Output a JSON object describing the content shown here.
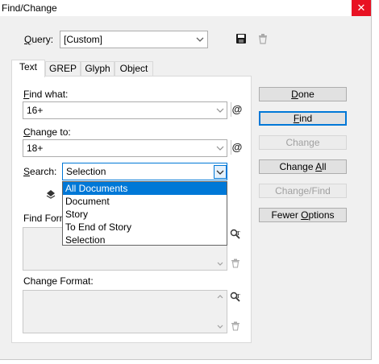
{
  "window": {
    "title": "Find/Change",
    "close_glyph": "✕"
  },
  "query": {
    "label_u": "Q",
    "label_rest": "uery:",
    "value": "[Custom]",
    "save_icon": "save-query-icon",
    "delete_icon": "delete-query-icon"
  },
  "tabs": [
    {
      "label": "Text"
    },
    {
      "label": "GREP"
    },
    {
      "label": "Glyph"
    },
    {
      "label": "Object"
    }
  ],
  "find_what": {
    "label_u": "F",
    "label_rest": "ind what:",
    "value": "16+",
    "special_char_glyph": "@"
  },
  "change_to": {
    "label_u": "C",
    "label_rest": "hange to:",
    "value": "18+",
    "special_char_glyph": "@"
  },
  "search": {
    "label_u": "S",
    "label_rest": "earch:",
    "value": "Selection",
    "options": [
      {
        "label": "All Documents",
        "selected": true
      },
      {
        "label": "Document",
        "selected": false
      },
      {
        "label": "Story",
        "selected": false
      },
      {
        "label": "To End of Story",
        "selected": false
      },
      {
        "label": "Selection",
        "selected": false
      }
    ]
  },
  "find_format": {
    "label_visible": "Find Form"
  },
  "change_format": {
    "label": "Change Format:"
  },
  "buttons": {
    "done_u": "D",
    "done_rest": "one",
    "find_u": "F",
    "find_rest": "ind",
    "change": "Change",
    "change_all_pre": "Change ",
    "change_all_u": "A",
    "change_all_post": "ll",
    "change_find": "Change/Find",
    "fewer_pre": "Fewer ",
    "fewer_u": "O",
    "fewer_post": "ptions"
  },
  "colors": {
    "accent": "#0078d7",
    "close": "#e81123",
    "dialog_bg": "#f0f0f0"
  }
}
